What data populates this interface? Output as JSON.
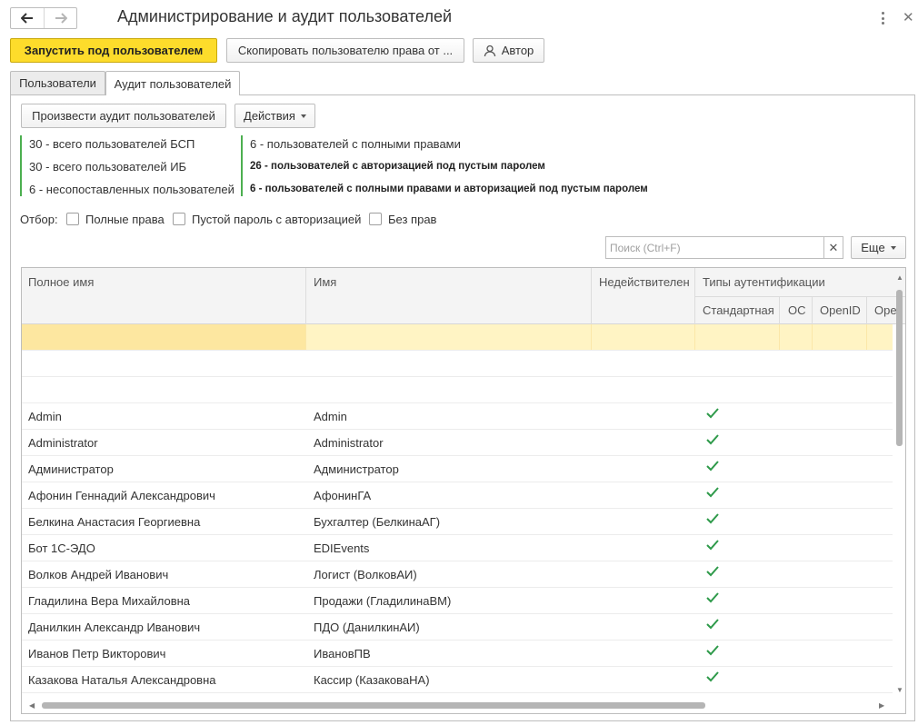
{
  "window": {
    "title": "Администрирование и аудит пользователей"
  },
  "toolbar": {
    "run_as_user": "Запустить под пользователем",
    "copy_rights": "Скопировать пользователю права от ...",
    "author": "Автор"
  },
  "tabs": [
    {
      "label": "Пользователи",
      "active": false
    },
    {
      "label": "Аудит пользователей",
      "active": true
    }
  ],
  "audit": {
    "run_audit": "Произвести аудит пользователей",
    "actions": "Действия"
  },
  "stats": {
    "left": [
      "30 - всего пользователей БСП",
      "30 - всего пользователей ИБ",
      "6 - несопоставленных пользователей"
    ],
    "right": [
      "6 - пользователей с полными правами",
      "26 - пользователей с авторизацией под пустым паролем",
      "6 - пользователей с полными правами и авторизацией под пустым паролем"
    ]
  },
  "filter": {
    "label": "Отбор:",
    "options": [
      "Полные права",
      "Пустой пароль с авторизацией",
      "Без прав"
    ]
  },
  "search": {
    "placeholder": "Поиск (Ctrl+F)",
    "more": "Еще"
  },
  "table": {
    "columns": {
      "full_name": "Полное имя",
      "name": "Имя",
      "invalid": "Недействителен",
      "auth_types": "Типы аутентификации",
      "standard": "Стандартная",
      "os": "ОС",
      "openid": "OpenID",
      "openid_connect": "Ope"
    },
    "rows": [
      {
        "full_name": "Admin",
        "name": "Admin",
        "standard": true
      },
      {
        "full_name": "Administrator",
        "name": "Administrator",
        "standard": true
      },
      {
        "full_name": "Администратор",
        "name": "Администратор",
        "standard": true
      },
      {
        "full_name": "Афонин Геннадий Александрович",
        "name": "АфонинГА",
        "standard": true
      },
      {
        "full_name": "Белкина Анастасия Георгиевна",
        "name": "Бухгалтер (БелкинаАГ)",
        "standard": true
      },
      {
        "full_name": "Бот 1С-ЭДО",
        "name": "EDIEvents",
        "standard": true
      },
      {
        "full_name": "Волков Андрей Иванович",
        "name": "Логист (ВолковАИ)",
        "standard": true
      },
      {
        "full_name": "Гладилина Вера Михайловна",
        "name": "Продажи (ГладилинаВМ)",
        "standard": true
      },
      {
        "full_name": "Данилкин Александр Иванович",
        "name": "ПДО (ДанилкинАИ)",
        "standard": true
      },
      {
        "full_name": "Иванов Петр Викторович",
        "name": "ИвановПВ",
        "standard": true
      },
      {
        "full_name": "Казакова Наталья Александровна",
        "name": "Кассир (КазаковаНА)",
        "standard": true
      }
    ]
  },
  "colors": {
    "primary_button": "#fddc2b",
    "selected_row": "#fff4c4",
    "selected_cell": "#fde7a0",
    "check": "#2e9a4a",
    "stats_bar": "#4caf50"
  }
}
